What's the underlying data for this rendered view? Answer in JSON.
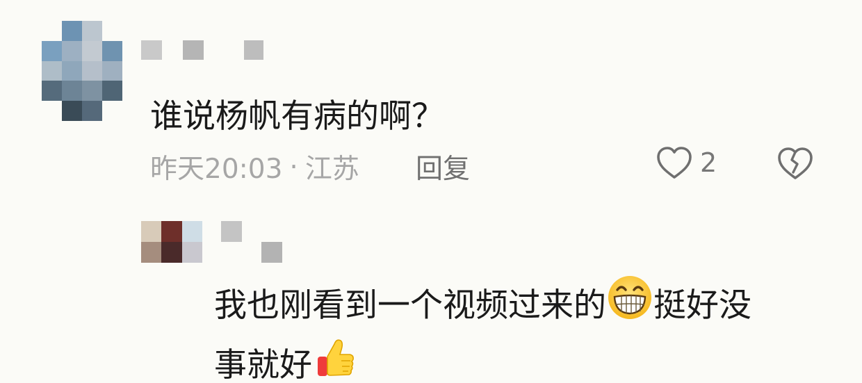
{
  "comment": {
    "text": "谁说杨帆有病的啊？",
    "time": "昨天20:03",
    "separator": "·",
    "location": "江苏",
    "reply_label": "回复",
    "like_count": "2",
    "icons": {
      "like": "heart-outline-icon",
      "dislike": "broken-heart-icon"
    }
  },
  "reply": {
    "line1_part1": "我也刚看到一个视频过来的",
    "line1_emoji": "grinning-face-emoji",
    "line1_part2": "挺好没",
    "line2_text": "事就好",
    "line2_emoji": "thumbs-up-emoji"
  },
  "colors": {
    "background": "#fbfbf7",
    "text": "#1a1a1a",
    "meta": "#a6a6a6",
    "reply_label": "#707070",
    "icon_gray": "#6f6f6f"
  }
}
